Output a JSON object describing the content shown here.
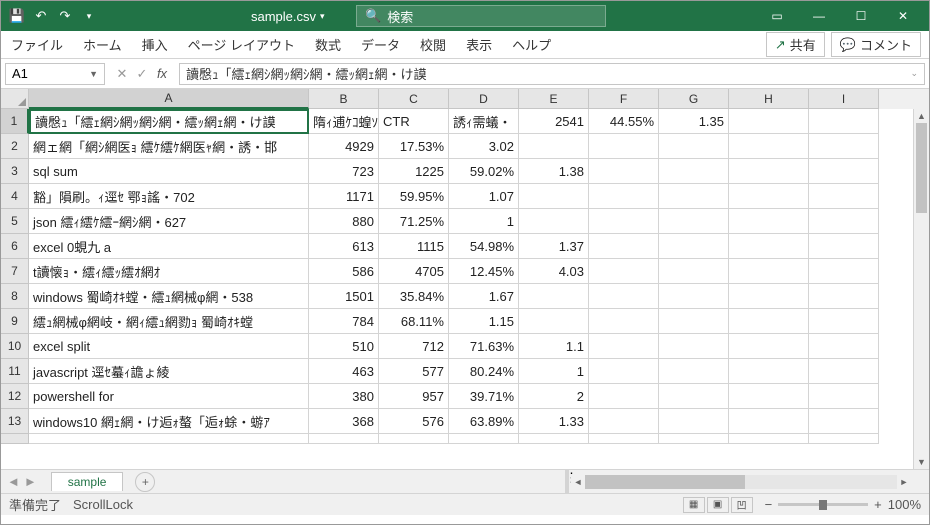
{
  "titlebar": {
    "filename": "sample.csv",
    "search_placeholder": "検索"
  },
  "ribbon": {
    "tabs": [
      "ファイル",
      "ホーム",
      "挿入",
      "ページ レイアウト",
      "数式",
      "データ",
      "校閲",
      "表示",
      "ヘルプ"
    ],
    "share": "共有",
    "comment": "コメント"
  },
  "formula": {
    "namebox": "A1",
    "content": "讀慇ｭ「繧ｪ網ｼ網ｯ網ｼ網・繧ｯ網ｪ網・け謨"
  },
  "cols": {
    "A_w": 280,
    "B_w": 70,
    "C_w": 70,
    "D_w": 70,
    "E_w": 70,
    "F_w": 70,
    "G_w": 70,
    "H_w": 80,
    "I_w": 70,
    "labels": [
      "A",
      "B",
      "C",
      "D",
      "E",
      "F",
      "G",
      "H",
      "I"
    ]
  },
  "grid": [
    {
      "r": 1,
      "A": "讀慇ｭ「繧ｪ網ｼ網ｯ網ｼ網・繧ｯ網ｪ網・け謨",
      "B": "隋ｨ逋ｹｺ蝗ｿ",
      "C": "CTR",
      "D": "誘ｨ需蟻・",
      "E": "2541",
      "F": "44.55%",
      "G": "1.35"
    },
    {
      "r": 2,
      "A": "網ェ網「網ｼ網医ｮ 繧ｹ繧ｹ網医ｬ網・誘・邯",
      "B": "4929",
      "C": "17.53%",
      "D": "3.02"
    },
    {
      "r": 3,
      "A": "sql sum",
      "B": "723",
      "C": "1225",
      "D": "59.02%",
      "E": "1.38"
    },
    {
      "r": 4,
      "A": "豁」隕刷。ｨ逕ｾ 鄂ｮ謠・702",
      "B": "1171",
      "C": "59.95%",
      "D": "1.07"
    },
    {
      "r": 5,
      "A": "json 繧ｨ繧ｹ繧ｰ網ｼ網・627",
      "B": "880",
      "C": "71.25%",
      "D": "1"
    },
    {
      "r": 6,
      "A": "excel 0蜆九 a",
      "B": "613",
      "C": "1115",
      "D": "54.98%",
      "E": "1.37"
    },
    {
      "r": 7,
      "A": "t讀懐ｮ・繧ｨ繧ｯ繧ｵ網ｵ",
      "B": "586",
      "C": "4705",
      "D": "12.45%",
      "E": "4.03"
    },
    {
      "r": 8,
      "A": "windows 蜀崎ｵｷ螳・繧ｭ網械φ網・538",
      "B": "1501",
      "C": "35.84%",
      "D": "1.67"
    },
    {
      "r": 9,
      "A": "繧ｭ網械φ網岐・網ｨ繧ｭ網勠ｮ 蜀崎ｵｷ螳",
      "B": "784",
      "C": "68.11%",
      "D": "1.15"
    },
    {
      "r": 10,
      "A": "excel split",
      "B": "510",
      "C": "712",
      "D": "71.63%",
      "E": "1.1"
    },
    {
      "r": 11,
      "A": "javascript 逕ｾ蟇ｨ譫ょ綾",
      "B": "463",
      "C": "577",
      "D": "80.24%",
      "E": "1"
    },
    {
      "r": 12,
      "A": "powershell for",
      "B": "380",
      "C": "957",
      "D": "39.71%",
      "E": "2"
    },
    {
      "r": 13,
      "A": "windows10 網ｪ網・け逅ｫ螯「逅ｫ蜍・蝣ｱ",
      "B": "368",
      "C": "576",
      "D": "63.89%",
      "E": "1.33"
    }
  ],
  "sheet": {
    "name": "sample"
  },
  "status": {
    "ready": "準備完了",
    "scroll": "ScrollLock",
    "zoom": "100%"
  }
}
